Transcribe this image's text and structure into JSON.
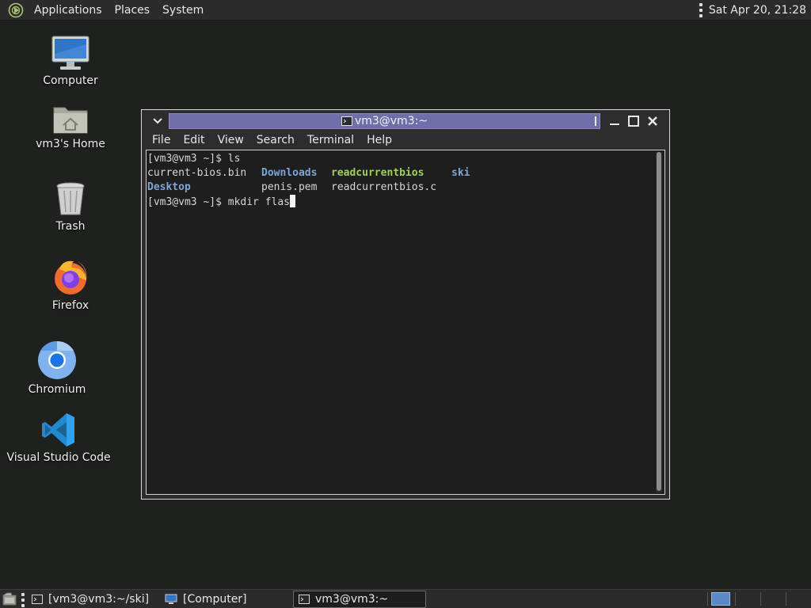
{
  "top_panel": {
    "menus": [
      "Applications",
      "Places",
      "System"
    ],
    "clock": "Sat Apr 20, 21:28"
  },
  "desktop_icons": [
    {
      "label": "Computer",
      "icon": "computer-icon"
    },
    {
      "label": "vm3's Home",
      "icon": "home-folder-icon"
    },
    {
      "label": "Trash",
      "icon": "trash-icon"
    },
    {
      "label": "Firefox",
      "icon": "firefox-icon"
    },
    {
      "label": "Chromium",
      "icon": "chromium-icon"
    },
    {
      "label": "Visual Studio Code",
      "icon": "vscode-icon"
    }
  ],
  "terminal": {
    "title": "vm3@vm3:~",
    "menu": [
      "File",
      "Edit",
      "View",
      "Search",
      "Terminal",
      "Help"
    ],
    "lines": {
      "l1": "[vm3@vm3 ~]$ ls",
      "ls_row1": [
        "current-bios.bin",
        "Downloads",
        "readcurrentbios",
        "ski"
      ],
      "ls_row2": [
        "Desktop",
        "penis.pem",
        "readcurrentbios.c"
      ],
      "l3": "[vm3@vm3 ~]$ mkdir flas"
    },
    "colors": {
      "directory": "#7aa6d9",
      "executable": "#9ed34a"
    }
  },
  "taskbar": {
    "items": [
      {
        "label": "[vm3@vm3:~/ski]",
        "active": false
      },
      {
        "label": "[Computer]",
        "active": false
      },
      {
        "label": "vm3@vm3:~",
        "active": true
      }
    ]
  }
}
